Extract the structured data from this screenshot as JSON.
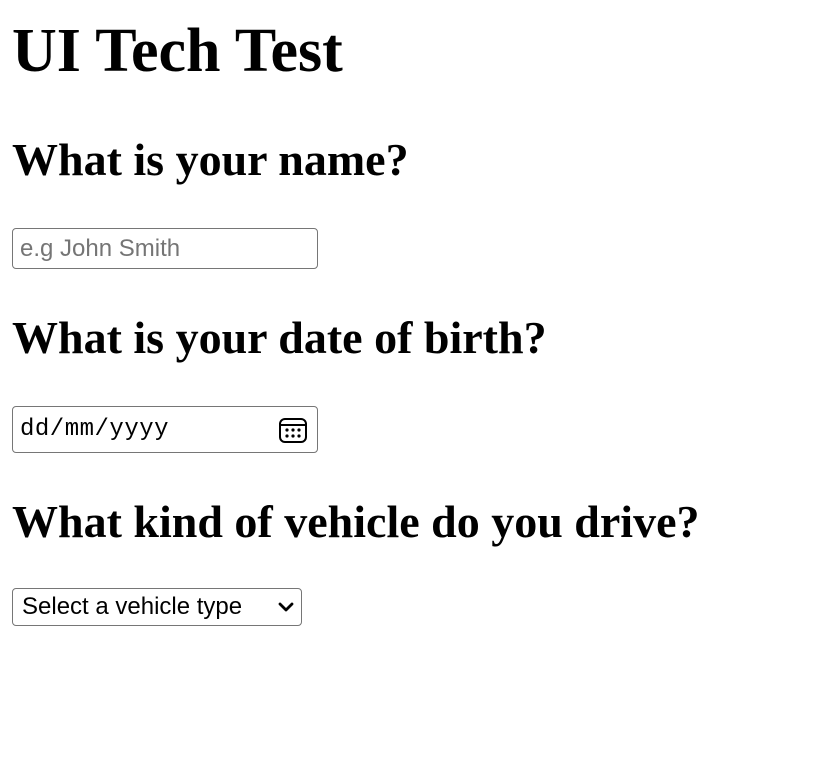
{
  "page": {
    "title": "UI Tech Test"
  },
  "questions": {
    "name": {
      "label": "What is your name?",
      "placeholder": "e.g John Smith",
      "value": ""
    },
    "dob": {
      "label": "What is your date of birth?",
      "display": "dd/mm/yyyy",
      "icon": "calendar-icon"
    },
    "vehicle": {
      "label": "What kind of vehicle do you drive?",
      "selected": "Select a vehicle type",
      "icon": "chevron-down-icon"
    }
  }
}
